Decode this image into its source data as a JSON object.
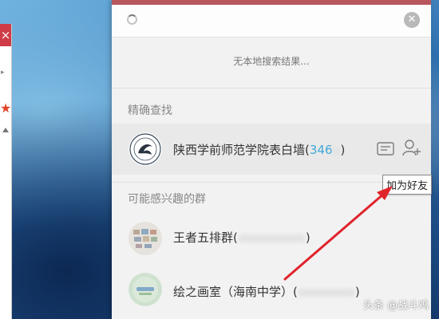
{
  "search": {
    "query": "",
    "placeholder": ""
  },
  "status": {
    "no_local_results": "无本地搜索结果..."
  },
  "sections": {
    "exact": "精确查找",
    "recommended": "可能感兴趣的群"
  },
  "exact_result": {
    "name": "陕西学前师范学院表白墙",
    "paren_open": "(",
    "id_partial": "346",
    "paren_close": ")"
  },
  "groups": [
    {
      "name": "王者五排群",
      "paren_open": "(",
      "paren_close": ")"
    },
    {
      "name": "绘之画室（海南中学）",
      "paren_open": "(",
      "paren_close": ")"
    }
  ],
  "tooltip": {
    "add_friend": "加为好友"
  },
  "watermark": {
    "text": "头条 @战斗鸡"
  },
  "left_window": {
    "close_glyph": "×"
  },
  "colors": {
    "accent": "#3fa6d8",
    "annotation_arrow": "#e0242c",
    "close_red": "#cf3c47",
    "topbar": "#b7565c"
  },
  "icons": {
    "clear": "close-circle-icon",
    "chat": "message-icon",
    "add_friend": "add-user-icon",
    "loading": "spinner-icon"
  }
}
